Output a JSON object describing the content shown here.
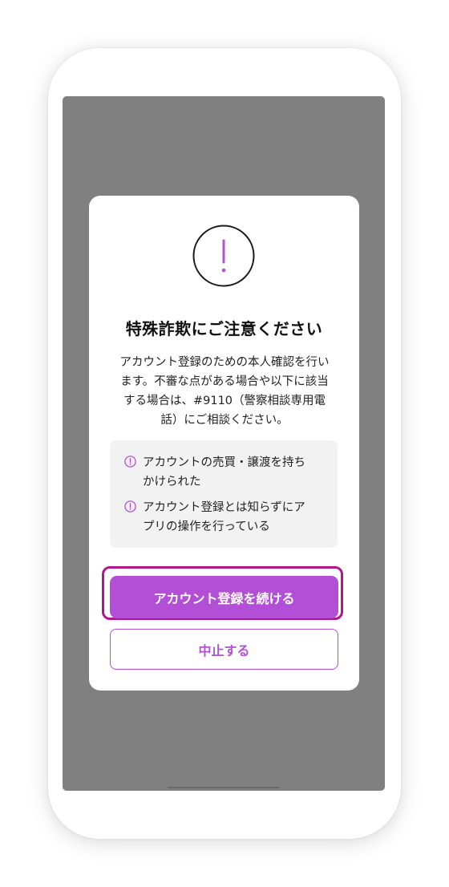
{
  "dialog": {
    "title": "特殊詐欺にご注意ください",
    "description_lines": [
      "アカウント登録のための本人確認を行い",
      "ます。不審な点がある場合や以下に該当",
      "する場合は、#9110（警察相談専用電",
      "話）にご相談ください。"
    ],
    "warnings": [
      {
        "lines": [
          "アカウントの売買・譲渡を持ち",
          "かけられた"
        ]
      },
      {
        "lines": [
          "アカウント登録とは知らずにア",
          "プリの操作を行っている"
        ]
      }
    ],
    "primary_button": "アカウント登録を続ける",
    "secondary_button": "中止する"
  },
  "icons": {
    "main": "exclamation-circle-icon",
    "warning": "info-circle-icon"
  },
  "colors": {
    "accent": "#b34fd6",
    "focus_ring": "#b0168d",
    "overlay": "#808080",
    "warning_bg": "#f2f2f2"
  }
}
